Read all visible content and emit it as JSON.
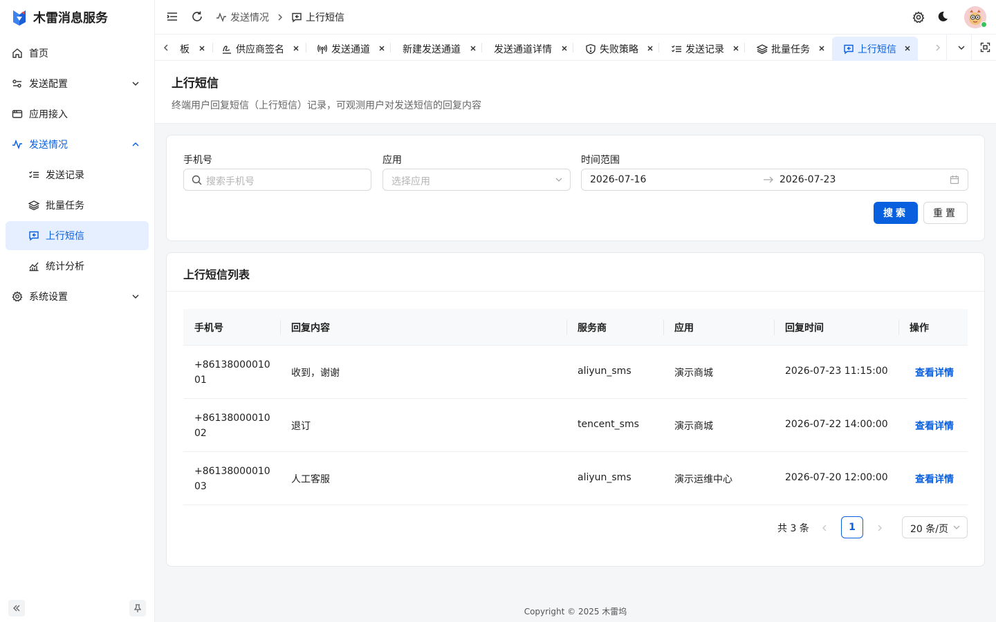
{
  "app": {
    "title": "木雷消息服务"
  },
  "sidebar": {
    "items": [
      {
        "label": "首页"
      },
      {
        "label": "发送配置"
      },
      {
        "label": "应用接入"
      },
      {
        "label": "发送情况"
      },
      {
        "label": "发送记录"
      },
      {
        "label": "批量任务"
      },
      {
        "label": "上行短信"
      },
      {
        "label": "统计分析"
      },
      {
        "label": "系统设置"
      }
    ]
  },
  "breadcrumb": {
    "parent": "发送情况",
    "current": "上行短信"
  },
  "tabs": [
    {
      "label": "板"
    },
    {
      "label": "供应商签名"
    },
    {
      "label": "发送通道"
    },
    {
      "label": "新建发送通道"
    },
    {
      "label": "发送通道详情"
    },
    {
      "label": "失败策略"
    },
    {
      "label": "发送记录"
    },
    {
      "label": "批量任务"
    },
    {
      "label": "上行短信"
    }
  ],
  "page": {
    "title": "上行短信",
    "description": "终端用户回复短信（上行短信）记录，可观测用户对发送短信的回复内容"
  },
  "filters": {
    "phone_label": "手机号",
    "phone_placeholder": "搜索手机号",
    "app_label": "应用",
    "app_placeholder": "选择应用",
    "range_label": "时间范围",
    "range_start": "2026-07-16",
    "range_end": "2026-07-23",
    "search_label": "搜索",
    "reset_label": "重置"
  },
  "list": {
    "title": "上行短信列表",
    "columns": [
      "手机号",
      "回复内容",
      "服务商",
      "应用",
      "回复时间",
      "操作"
    ],
    "rows": [
      {
        "phone": "+8613800001001",
        "content": "收到，谢谢",
        "provider": "aliyun_sms",
        "app": "演示商城",
        "time": "2026-07-23 11:15:00",
        "action": "查看详情"
      },
      {
        "phone": "+8613800001002",
        "content": "退订",
        "provider": "tencent_sms",
        "app": "演示商城",
        "time": "2026-07-22 14:00:00",
        "action": "查看详情"
      },
      {
        "phone": "+8613800001003",
        "content": "人工客服",
        "provider": "aliyun_sms",
        "app": "演示运维中心",
        "time": "2026-07-20 12:00:00",
        "action": "查看详情"
      }
    ]
  },
  "pagination": {
    "total": "共 3 条",
    "current": "1",
    "page_size": "20 条/页"
  },
  "footer": {
    "copyright": "Copyright © 2025 木雷坞"
  },
  "colors": {
    "primary": "#0960de",
    "active_bg": "#e6efff",
    "online": "#37c25c"
  }
}
